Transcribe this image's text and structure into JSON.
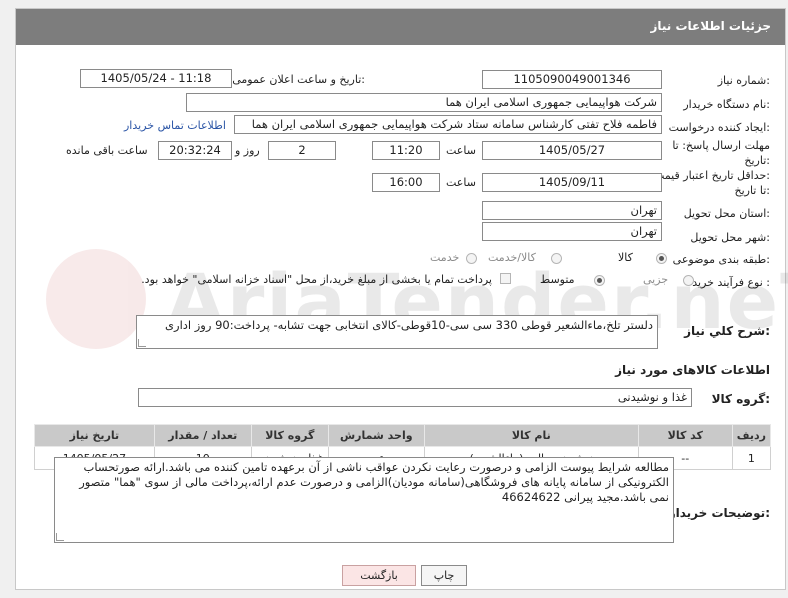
{
  "header": {
    "title": "جزئیات اطلاعات نیاز"
  },
  "form": {
    "need_number": {
      "label": "شماره نیاز:",
      "value": "1105090049001346"
    },
    "announce": {
      "label": "تاریخ و ساعت اعلان عمومی:",
      "value": "1405/05/24 - 11:18"
    },
    "buyer": {
      "label": "نام دستگاه خریدار:",
      "value": "شرکت هواپیمایی جمهوری اسلامی ایران هما"
    },
    "creator": {
      "label": "ایجاد کننده درخواست:",
      "value": "فاطمه فلاح تفتی کارشناس سامانه ستاد شرکت هواپیمایی جمهوری اسلامی ایران هما",
      "contact_link": "اطلاعات تماس خریدار"
    },
    "deadline": {
      "label1": "مهلت ارسال پاسخ: تا",
      "label2": "تاریخ:",
      "date": "1405/05/27",
      "time_label": "ساعت",
      "time": "11:20",
      "days": "2",
      "days_label": "روز و",
      "remaining": "20:32:24",
      "remaining_label": "ساعت باقی مانده"
    },
    "validity": {
      "label1": "حداقل تاریخ اعتبار قیمت:",
      "label2": "تا تاریخ:",
      "date": "1405/09/11",
      "time_label": "ساعت",
      "time": "16:00"
    },
    "province": {
      "label": "استان محل تحویل:",
      "value": "تهران"
    },
    "city": {
      "label": "شهر محل تحویل:",
      "value": "تهران"
    },
    "category": {
      "label": "طبقه بندی موضوعی:",
      "options": [
        "کالا",
        "کالا/خدمت",
        "خدمت"
      ]
    },
    "process": {
      "label": "نوع فرآیند خرید :",
      "options": [
        "جزیی",
        "متوسط"
      ],
      "note": "پرداخت تمام یا بخشی از مبلغ خرید،از محل \"اسناد خزانه اسلامی\" خواهد بود."
    },
    "description": {
      "label": "شرح کلي نياز:",
      "value": "دلستر تلخ،ماءالشعیر قوطی 330 سی سی-10قوطی-کالای انتخابی جهت تشابه- پرداخت:90 روز اداری"
    }
  },
  "goods": {
    "section_title": "اطلاعات کالاهای مورد نیاز",
    "group_label": "گروه کالا:",
    "group_value": "غذا و نوشیدنی",
    "columns": [
      "ردیف",
      "کد کالا",
      "نام کالا",
      "واحد شمارش",
      "گروه کالا",
      "تعداد / مقدار",
      "تاریخ نیاز"
    ],
    "rows": [
      [
        "1",
        "--",
        "نوشیدنی مالت (ماءالشعیر)",
        "عدد",
        "غذا و نوشیدنی",
        "10",
        "1405/05/27"
      ]
    ]
  },
  "notes": {
    "label": "توضیحات خریدار:",
    "value": "مطالعه شرایط پیوست الزامی و درصورت رعایت نکردن عواقب ناشی از آن برعهده تامین کننده می باشد.ارائه صورتحساب الکترونیکی از سامانه پایانه های فروشگاهی(سامانه مودیان)الزامی و درصورت عدم ارائه،پرداخت مالی از سوی \"هما\" متصور نمی باشد.مجید پیرانی 46624622"
  },
  "buttons": {
    "print": "چاپ",
    "back": "بازگشت"
  },
  "watermark": "AriaTender.neT",
  "colors": {
    "header_bg": "#7d7d7d",
    "link": "#2b55a6",
    "table_header": "#c9c9c9",
    "back_button": "#fbe5e5"
  }
}
